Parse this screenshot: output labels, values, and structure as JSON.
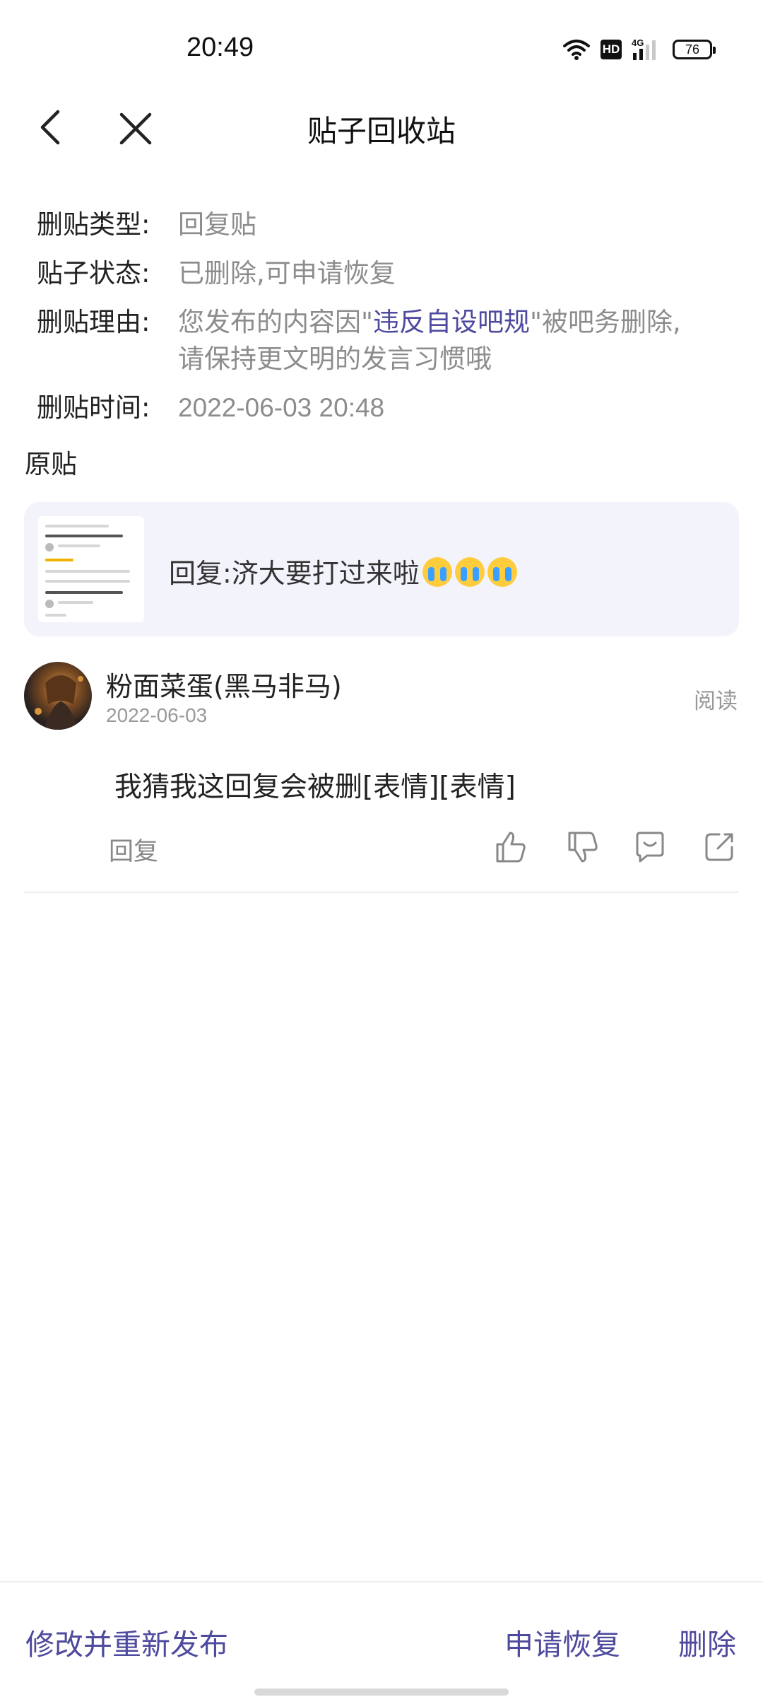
{
  "status_bar": {
    "time": "20:49",
    "hd": "HD",
    "network": "4G",
    "battery": "76"
  },
  "nav": {
    "title": "贴子回收站"
  },
  "info": {
    "type_label": "删贴类型:",
    "type_value": "回复贴",
    "status_label": "贴子状态:",
    "status_value": "已删除,可申请恢复",
    "reason_label": "删贴理由:",
    "reason_prefix": "您发布的内容因\"",
    "reason_link": "违反自设吧规",
    "reason_suffix": "\"被吧务删除,",
    "reason_line2": "请保持更文明的发言习惯哦",
    "time_label": "删贴时间:",
    "time_value": "2022-06-03 20:48"
  },
  "original": {
    "section_label": "原贴",
    "title": "回复:济大要打过来啦",
    "emoji_count_icon": "crying-face"
  },
  "reply": {
    "user_name": "粉面菜蛋(黑马非马)",
    "date": "2022-06-03",
    "read_label": "阅读",
    "content": "我猜我这回复会被删[表情][表情]",
    "reply_label": "回复"
  },
  "bottom": {
    "edit_republish": "修改并重新发布",
    "apply_restore": "申请恢复",
    "delete": "删除"
  },
  "colors": {
    "accent": "#4e4a9e",
    "card_bg": "#f3f3fb",
    "muted_text": "#8c8c8c"
  }
}
